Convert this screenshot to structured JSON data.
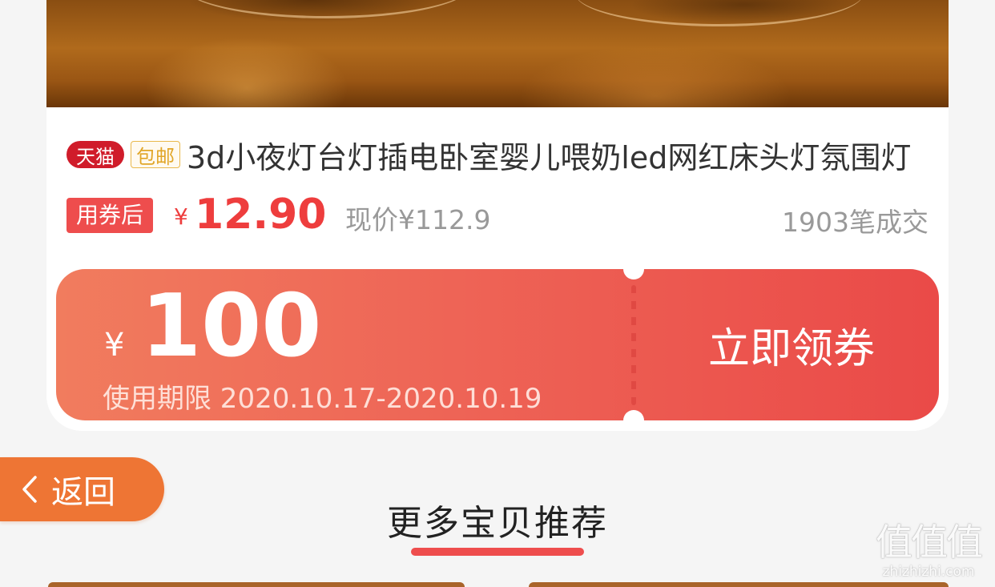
{
  "product": {
    "badge_tmall": "天猫",
    "badge_free_shipping": "包邮",
    "title": "3d小夜灯台灯插电卧室婴儿喂奶led网红床头灯氛围灯",
    "after_coupon_label": "用券后",
    "currency_symbol": "¥",
    "price_after_coupon": "12.90",
    "current_price": "现价¥112.9",
    "sales": "1903笔成交"
  },
  "coupon": {
    "currency_symbol": "¥",
    "amount": "100",
    "validity": "使用期限 2020.10.17-2020.10.19",
    "claim_label": "立即领券"
  },
  "nav": {
    "back_label": "返回"
  },
  "recommend": {
    "title": "更多宝贝推荐"
  },
  "watermark": {
    "logo": "值值值",
    "url": "zhizhizhi.com"
  },
  "colors": {
    "accent_red": "#ee3d3d",
    "coupon_start": "#f17c5e",
    "coupon_end": "#ea4a48",
    "back_button": "#ee7534",
    "tmall_red": "#d01c2a",
    "free_shipping_gold": "#e1a628"
  }
}
